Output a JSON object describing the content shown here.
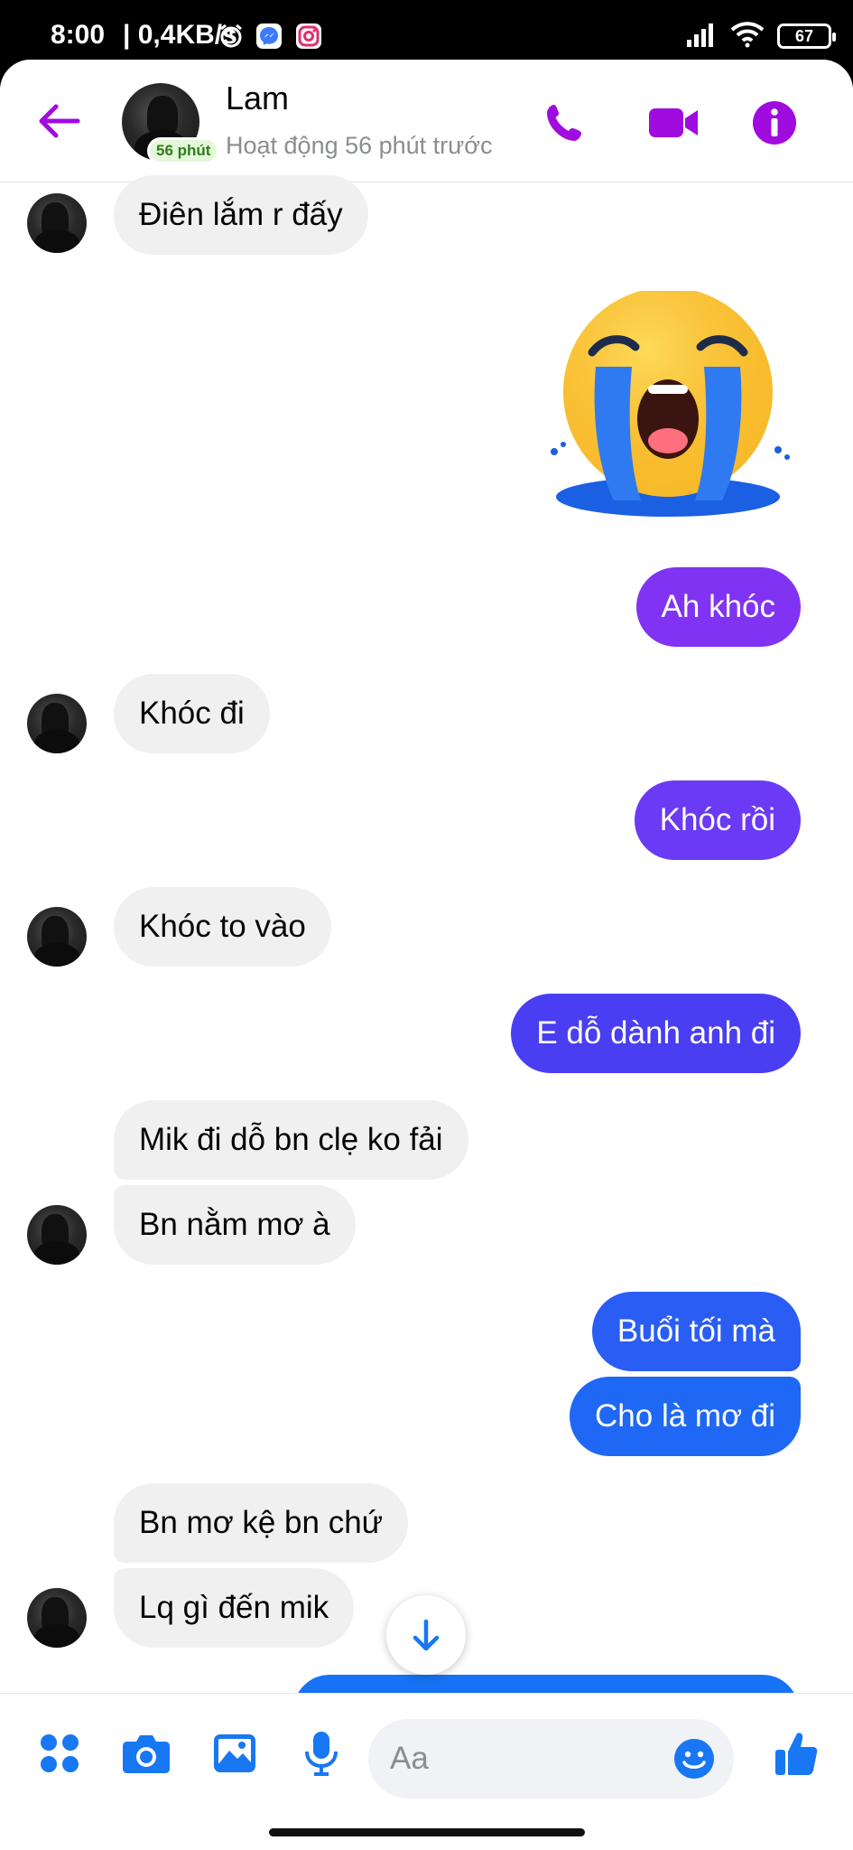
{
  "status_bar": {
    "time": "8:00",
    "net_speed": "0,4KB/s",
    "battery": "67"
  },
  "header": {
    "contact_name": "Lam",
    "active_badge": "56 phút",
    "status": "Hoạt động 56 phút trước"
  },
  "messages": [
    {
      "side": "in",
      "text": "Điên lắm r đấy"
    },
    {
      "side": "out",
      "type": "emoji",
      "emoji": "loudly-crying-face"
    },
    {
      "side": "out",
      "text": "Ah khóc"
    },
    {
      "side": "in",
      "text": "Khóc đi"
    },
    {
      "side": "out",
      "text": "Khóc rồi"
    },
    {
      "side": "in",
      "text": "Khóc to vào"
    },
    {
      "side": "out",
      "text": "E dỗ dành anh đi"
    },
    {
      "side": "in",
      "text": "Mik đi dỗ bn clẹ ko fải"
    },
    {
      "side": "in",
      "text": "Bn nằm mơ à"
    },
    {
      "side": "out",
      "text": "Buổi tối mà"
    },
    {
      "side": "out",
      "text": "Cho là mơ đi"
    },
    {
      "side": "in",
      "text": "Bn mơ kệ bn chứ"
    },
    {
      "side": "in",
      "text": "Lq gì đến mik"
    }
  ],
  "composer": {
    "placeholder": "Aa"
  },
  "colors": {
    "accent": "#9b16e0",
    "bubble_purple": "#7a35f5",
    "bubble_indigo": "#4d3df2",
    "bubble_blue": "#1a6ef5",
    "incoming": "#f0f0f0"
  }
}
